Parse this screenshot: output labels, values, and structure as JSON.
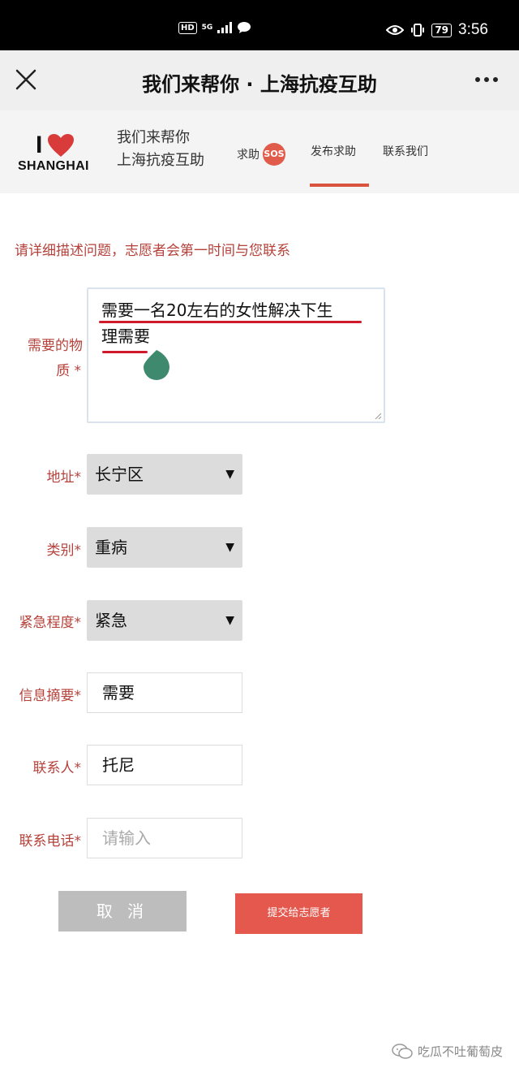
{
  "status_bar": {
    "hd": "HD",
    "network": "5G",
    "battery": "79",
    "time": "3:56"
  },
  "title_bar": {
    "title": "我们来帮你 · 上海抗疫互助"
  },
  "site_header": {
    "logo": {
      "i": "I",
      "word": "SHANGHAI",
      "heart_color": "#d93a3a"
    },
    "brand_line1": "我们来帮你",
    "brand_line2": "上海抗疫互助",
    "nav": {
      "help_label": "求助",
      "sos_badge": "SOS",
      "post_label": "发布求助",
      "contact_label": "联系我们"
    },
    "active_tab": "发布求助"
  },
  "form": {
    "instruction": "请详细描述问题，志愿者会第一时间与您联系",
    "materials": {
      "label_line1": "需要的物",
      "label_line2": "质 *",
      "value_line1": "需要一名20左右的女性解决下生",
      "value_line2": "理需要"
    },
    "address": {
      "label": "地址*",
      "value": "长宁区"
    },
    "category": {
      "label": "类别*",
      "value": "重病"
    },
    "urgency": {
      "label": "紧急程度*",
      "value": "紧急"
    },
    "summary": {
      "label": "信息摘要*",
      "value": "需要"
    },
    "contact_person": {
      "label": "联系人*",
      "value": "托尼"
    },
    "phone": {
      "label": "联系电话*",
      "placeholder": "请输入"
    },
    "cancel_label": "取 消",
    "submit_label": "提交给志愿者"
  },
  "watermark": {
    "text": "吃瓜不吐葡萄皮"
  },
  "colors": {
    "accent_red": "#d9533f",
    "label_red": "#b5413a",
    "submit_bg": "#e4584d",
    "cancel_bg": "#bdbdbd",
    "annotation_red": "#d0192b",
    "cursor_handle": "#3f8a6e"
  }
}
